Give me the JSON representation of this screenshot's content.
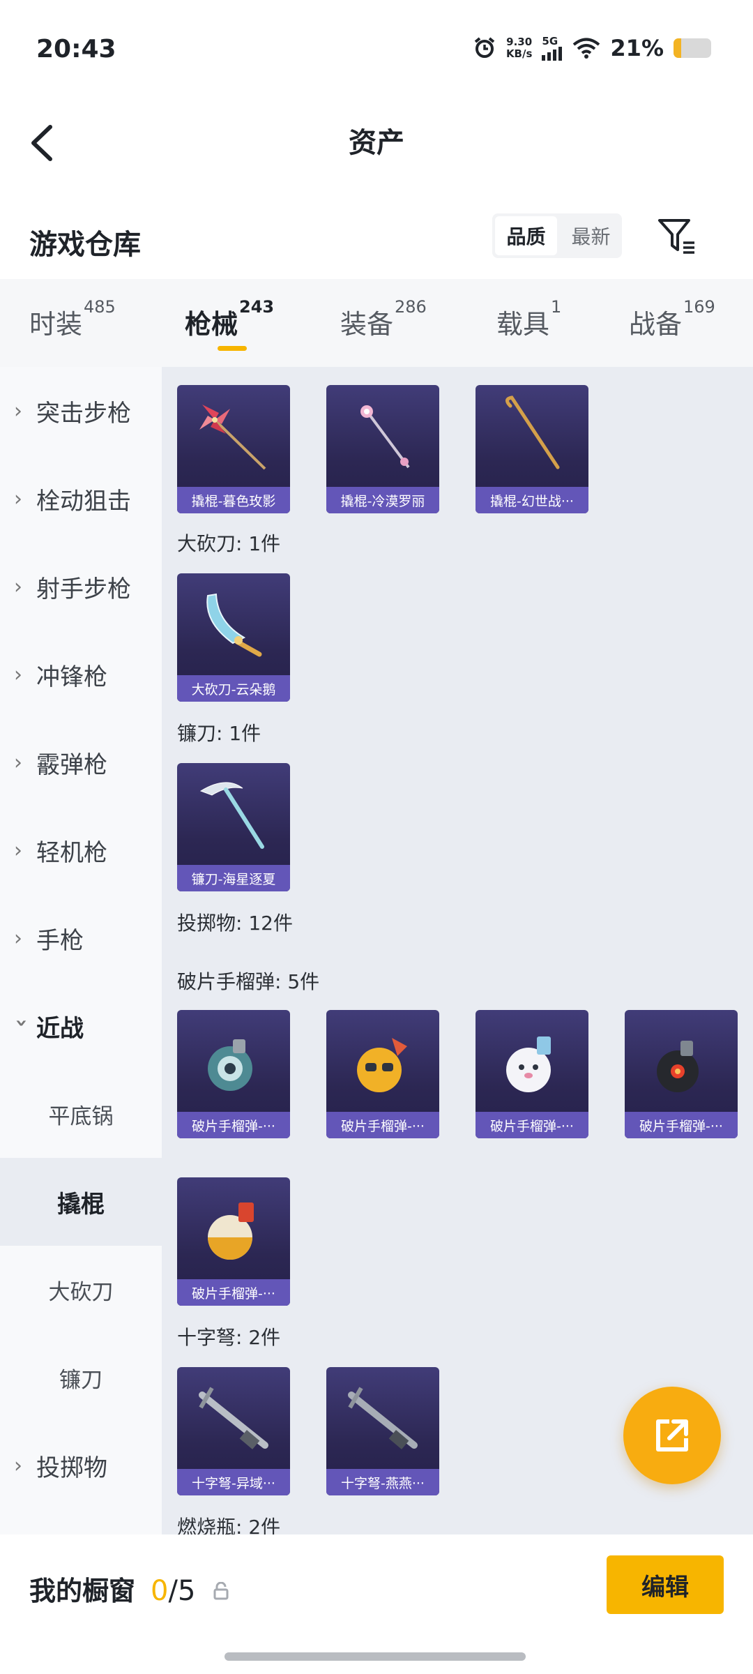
{
  "status": {
    "time": "20:43",
    "net_speed_top": "9.30",
    "net_speed_unit": "KB/s",
    "network": "5G",
    "battery": "21%",
    "battery_level": 0.21
  },
  "header": {
    "title": "资产"
  },
  "warehouse": {
    "title": "游戏仓库",
    "sort_quality": "品质",
    "sort_newest": "最新"
  },
  "tabs": [
    {
      "label": "时装",
      "count": "485"
    },
    {
      "label": "枪械",
      "count": "243"
    },
    {
      "label": "装备",
      "count": "286"
    },
    {
      "label": "载具",
      "count": "1"
    },
    {
      "label": "战备",
      "count": "169"
    }
  ],
  "sidebar": {
    "categories": [
      "突击步枪",
      "栓动狙击",
      "射手步枪",
      "冲锋枪",
      "霰弹枪",
      "轻机枪",
      "手枪",
      "近战"
    ],
    "sub_items": [
      "平底锅",
      "撬棍",
      "大砍刀",
      "镰刀"
    ],
    "last_category": "投掷物"
  },
  "content": {
    "crowbar_cards": [
      "撬棍-暮色玫影",
      "撬棍-冷漠罗丽",
      "撬棍-幻世战···"
    ],
    "machete_label": "大砍刀: 1件",
    "machete_cards": [
      "大砍刀-云朵鹅"
    ],
    "sickle_label": "镰刀: 1件",
    "sickle_cards": [
      "镰刀-海星逐夏"
    ],
    "throwables_label": "投掷物: 12件",
    "frag_label": "破片手榴弹: 5件",
    "frag_cards": [
      "破片手榴弹-···",
      "破片手榴弹-···",
      "破片手榴弹-···",
      "破片手榴弹-···",
      "破片手榴弹-···"
    ],
    "crossbow_label": "十字弩: 2件",
    "crossbow_cards": [
      "十字弩-异域···",
      "十字弩-燕燕···"
    ],
    "molotov_label": "燃烧瓶: 2件"
  },
  "bottom": {
    "showcase_title": "我的橱窗",
    "count_now": "0",
    "count_total": "/5",
    "edit_label": "编辑"
  },
  "colors": {
    "accent": "#f7b500",
    "card_bg": "#2c2753",
    "card_caption": "#6356b8"
  }
}
